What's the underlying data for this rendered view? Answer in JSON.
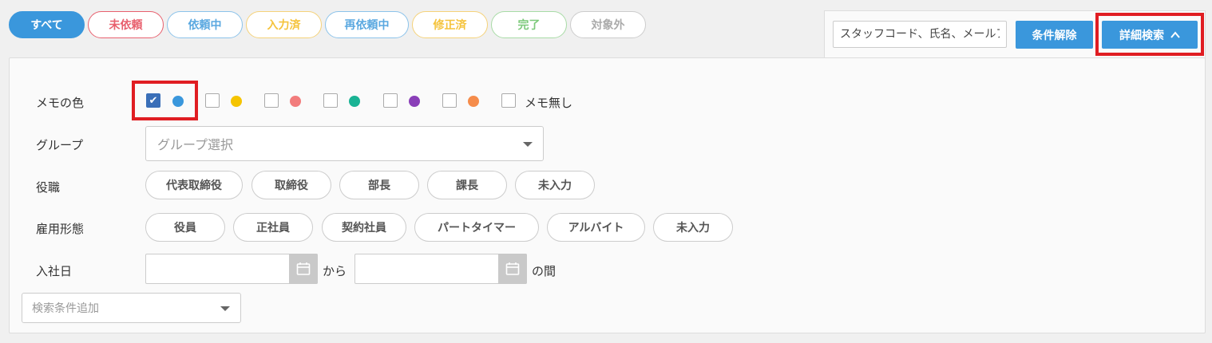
{
  "status_filters": [
    {
      "label": "すべて",
      "color": "#3a97dc",
      "active": true
    },
    {
      "label": "未依頼",
      "color": "#e8606e"
    },
    {
      "label": "依頼中",
      "color": "#5aa8e0"
    },
    {
      "label": "入力済",
      "color": "#f5c33b"
    },
    {
      "label": "再依頼中",
      "color": "#5aa8e0"
    },
    {
      "label": "修正済",
      "color": "#f5c33b"
    },
    {
      "label": "完了",
      "color": "#7cc97a"
    },
    {
      "label": "対象外",
      "color": "#aaaaaa"
    }
  ],
  "search": {
    "placeholder": "スタッフコード、氏名、メールアドレス",
    "clear_label": "条件解除",
    "detail_label": "詳細検索"
  },
  "memo": {
    "label": "メモの色",
    "colors": [
      "#3a97dc",
      "#f5c400",
      "#f27c7c",
      "#1ab394",
      "#8a3fb8",
      "#f58c4b"
    ],
    "checked_index": 0,
    "none_label": "メモ無し"
  },
  "group": {
    "label": "グループ",
    "placeholder": "グループ選択"
  },
  "position": {
    "label": "役職",
    "chips": [
      "代表取締役",
      "取締役",
      "部長",
      "課長",
      "未入力"
    ]
  },
  "employment": {
    "label": "雇用形態",
    "chips": [
      "役員",
      "正社員",
      "契約社員",
      "パートタイマー",
      "アルバイト",
      "未入力"
    ]
  },
  "hire_date": {
    "label": "入社日",
    "from_label": "から",
    "between_label": "の間"
  },
  "add_condition": {
    "placeholder": "検索条件追加"
  }
}
